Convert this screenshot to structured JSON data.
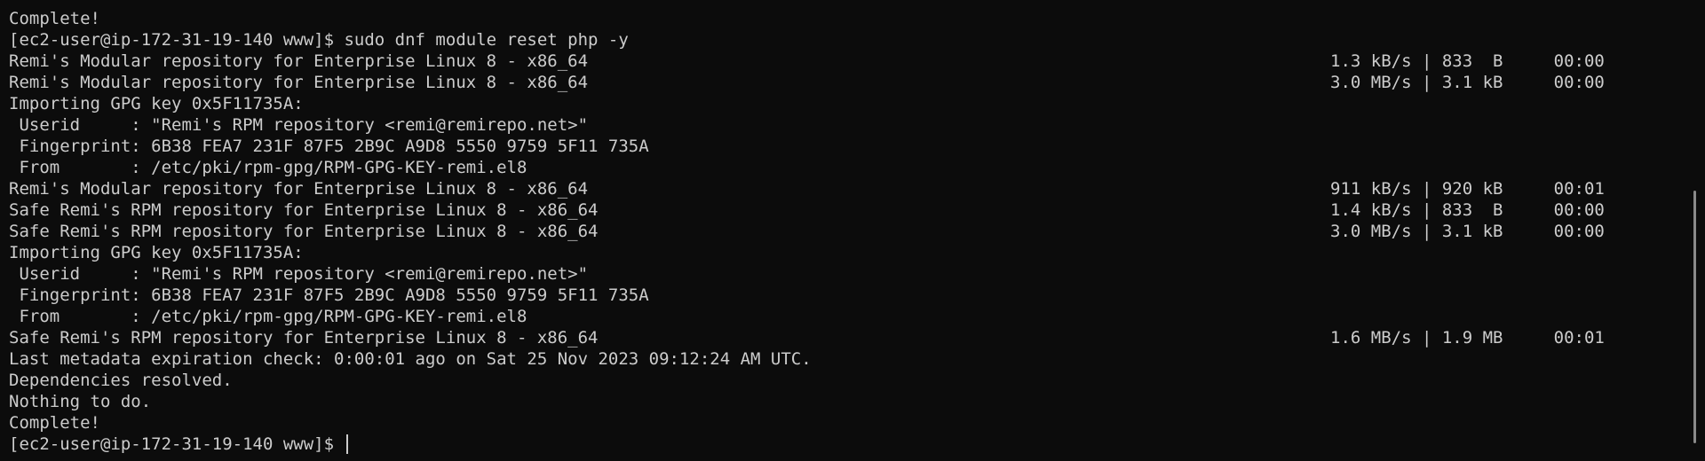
{
  "terminal": {
    "lines": [
      {
        "left": "Complete!",
        "right": ""
      },
      {
        "left": "[ec2-user@ip-172-31-19-140 www]$ sudo dnf module reset php -y",
        "right": ""
      },
      {
        "left": "Remi's Modular repository for Enterprise Linux 8 - x86_64",
        "right": "1.3 kB/s | 833  B     00:00"
      },
      {
        "left": "Remi's Modular repository for Enterprise Linux 8 - x86_64",
        "right": "3.0 MB/s | 3.1 kB     00:00"
      },
      {
        "left": "Importing GPG key 0x5F11735A:",
        "right": ""
      },
      {
        "left": " Userid     : \"Remi's RPM repository <remi@remirepo.net>\"",
        "right": ""
      },
      {
        "left": " Fingerprint: 6B38 FEA7 231F 87F5 2B9C A9D8 5550 9759 5F11 735A",
        "right": ""
      },
      {
        "left": " From       : /etc/pki/rpm-gpg/RPM-GPG-KEY-remi.el8",
        "right": ""
      },
      {
        "left": "Remi's Modular repository for Enterprise Linux 8 - x86_64",
        "right": "911 kB/s | 920 kB     00:01"
      },
      {
        "left": "Safe Remi's RPM repository for Enterprise Linux 8 - x86_64",
        "right": "1.4 kB/s | 833  B     00:00"
      },
      {
        "left": "Safe Remi's RPM repository for Enterprise Linux 8 - x86_64",
        "right": "3.0 MB/s | 3.1 kB     00:00"
      },
      {
        "left": "Importing GPG key 0x5F11735A:",
        "right": ""
      },
      {
        "left": " Userid     : \"Remi's RPM repository <remi@remirepo.net>\"",
        "right": ""
      },
      {
        "left": " Fingerprint: 6B38 FEA7 231F 87F5 2B9C A9D8 5550 9759 5F11 735A",
        "right": ""
      },
      {
        "left": " From       : /etc/pki/rpm-gpg/RPM-GPG-KEY-remi.el8",
        "right": ""
      },
      {
        "left": "Safe Remi's RPM repository for Enterprise Linux 8 - x86_64",
        "right": "1.6 MB/s | 1.9 MB     00:01"
      },
      {
        "left": "Last metadata expiration check: 0:00:01 ago on Sat 25 Nov 2023 09:12:24 AM UTC.",
        "right": ""
      },
      {
        "left": "Dependencies resolved.",
        "right": ""
      },
      {
        "left": "Nothing to do.",
        "right": ""
      },
      {
        "left": "Complete!",
        "right": ""
      }
    ],
    "prompt": "[ec2-user@ip-172-31-19-140 www]$ "
  }
}
